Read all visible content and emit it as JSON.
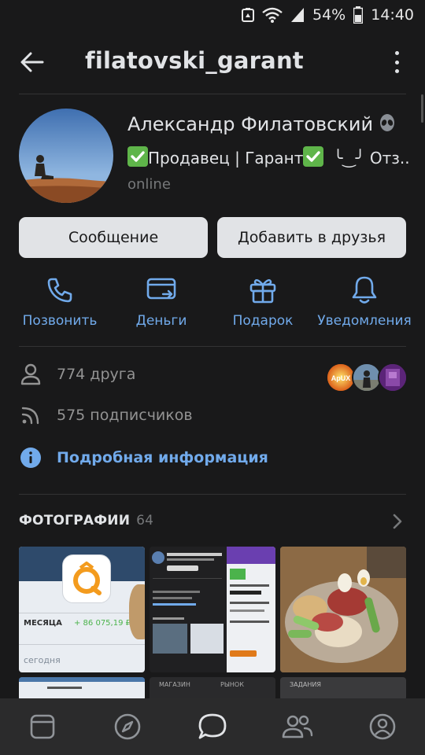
{
  "status_bar": {
    "battery": "54%",
    "time": "14:40"
  },
  "header": {
    "title": "filatovski_garant"
  },
  "profile": {
    "name": "Александр Филатовский",
    "status_seller": "Продавец | Гарант",
    "status_tail": "╰‿╯ Отз...",
    "online": "online"
  },
  "buttons": {
    "message": "Сообщение",
    "add_friend": "Добавить в друзья"
  },
  "actions": {
    "call": "Позвонить",
    "money": "Деньги",
    "gift": "Подарок",
    "notifications": "Уведомления"
  },
  "info": {
    "friends": "774 друга",
    "subscribers": "575 подписчиков",
    "details": "Подробная информация",
    "friend_badge_text": "ApUX"
  },
  "photos": {
    "title": "ФОТОГРАФИИ",
    "count": "64",
    "thumb1": {
      "amount": "+ 86 075,19 ₽",
      "month": "МЕСЯЦА",
      "today": "сегодня"
    },
    "row2_labels": {
      "shop": "МАГАЗИН",
      "market": "РЫНОК",
      "tasks": "ЗАДАНИЯ"
    }
  },
  "colors": {
    "background": "#19191a",
    "accent": "#71aaeb",
    "button_bg": "#e1e3e6",
    "secondary_text": "#939393",
    "nav_bg": "#2b2b2c",
    "check_green": "#5fb54a"
  },
  "bottom_nav": {
    "items": [
      "news-icon",
      "discover-icon",
      "messages-icon",
      "friends-icon",
      "profile-icon"
    ],
    "active": "messages-icon"
  }
}
